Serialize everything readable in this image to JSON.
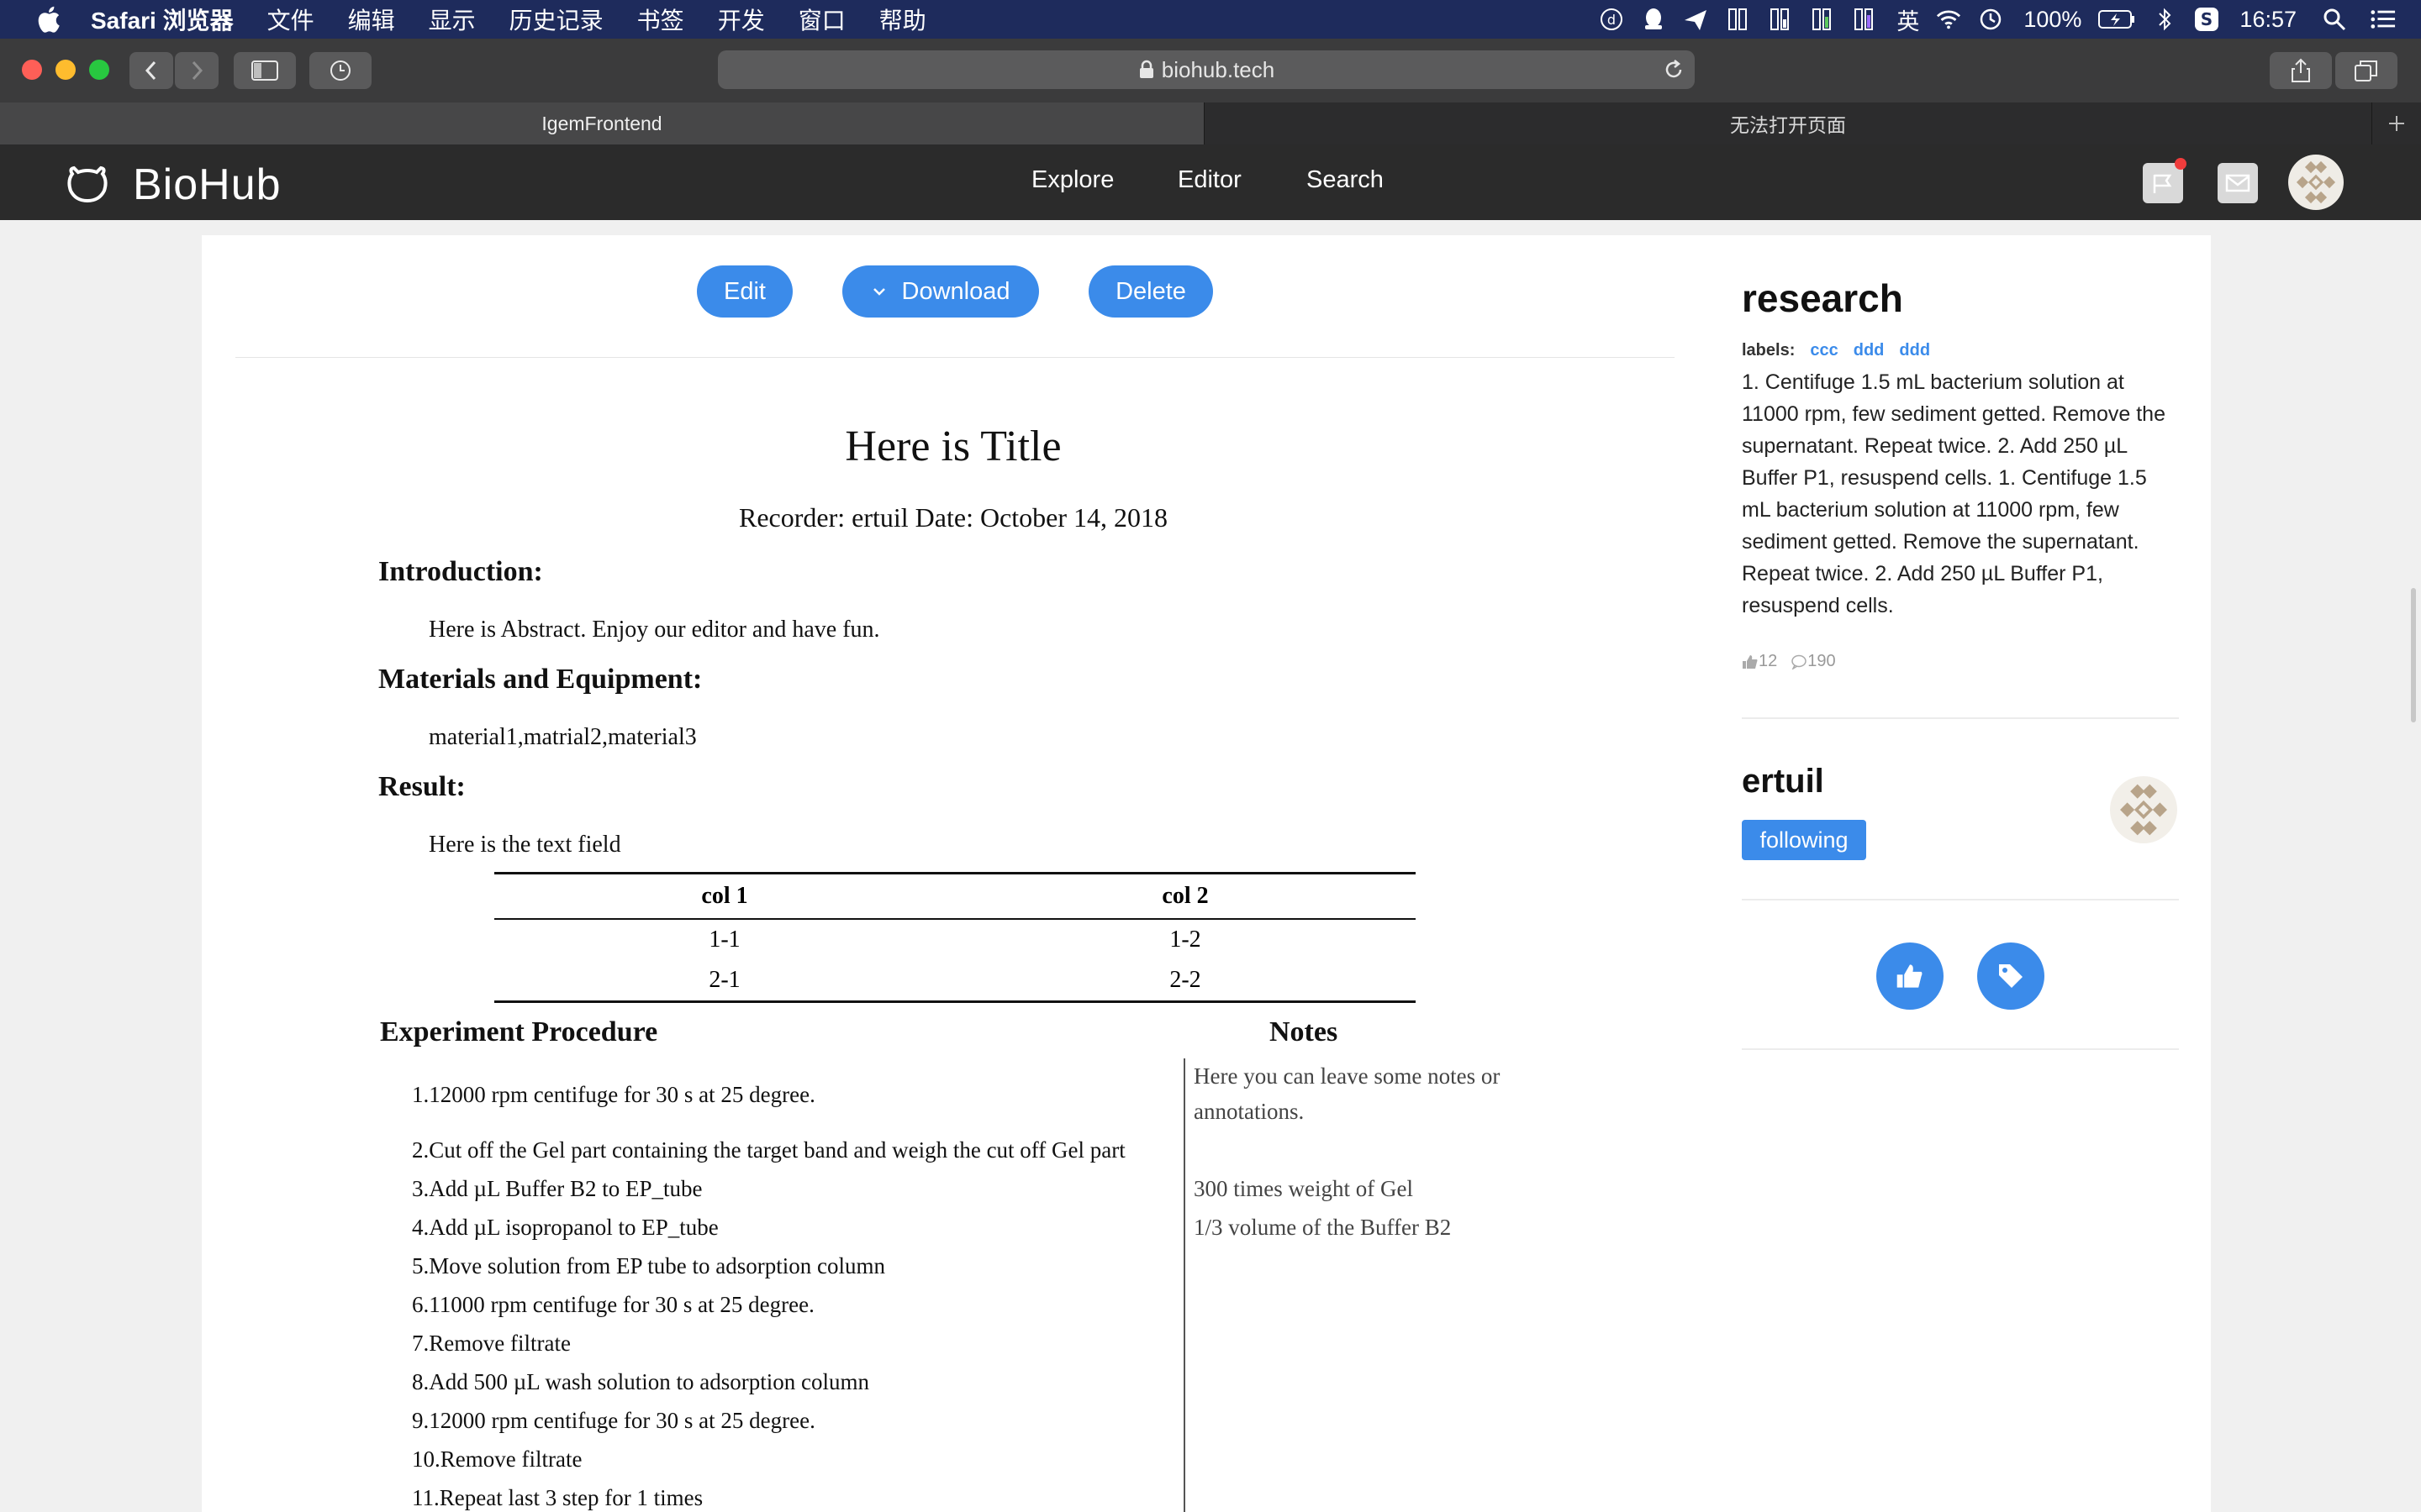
{
  "menubar": {
    "app": "Safari 浏览器",
    "items": [
      "文件",
      "编辑",
      "显示",
      "历史记录",
      "书签",
      "开发",
      "窗口",
      "帮助"
    ],
    "battery": "100%",
    "time": "16:57",
    "ime": "英"
  },
  "browser": {
    "url": "biohub.tech",
    "tabs": [
      {
        "label": "IgemFrontend",
        "active": true
      },
      {
        "label": "无法打开页面",
        "active": false
      }
    ]
  },
  "site": {
    "brand": "BioHub",
    "nav": [
      "Explore",
      "Editor",
      "Search"
    ]
  },
  "actions": {
    "edit": "Edit",
    "download": "Download",
    "delete": "Delete"
  },
  "doc": {
    "title": "Here is Title",
    "recorder": "Recorder: ertuil  Date: October 14, 2018",
    "intro_heading": "Introduction:",
    "intro_text": "Here is Abstract. Enjoy our editor and have fun.",
    "materials_heading": "Materials and Equipment:",
    "materials_text": "material1,matrial2,material3",
    "result_heading": "Result:",
    "result_text": "Here is the text field",
    "table": {
      "headers": [
        "col 1",
        "col 2"
      ],
      "rows": [
        [
          "1-1",
          "1-2"
        ],
        [
          "2-1",
          "2-2"
        ]
      ]
    },
    "procedure_heading": "Experiment Procedure",
    "notes_heading": "Notes",
    "steps": [
      "1.12000 rpm centifuge for 30 s at 25 degree.",
      "2.Cut off the Gel part containing the target band and weigh the cut off Gel part",
      "3.Add µL Buffer B2 to EP_tube",
      "4.Add µL isopropanol to EP_tube",
      "5.Move solution from EP tube to adsorption column",
      "6.11000 rpm centifuge for 30 s at 25 degree.",
      "7.Remove filtrate",
      "8.Add 500 µL wash solution to adsorption column",
      "9.12000 rpm centifuge for 30 s at 25 degree.",
      "10.Remove filtrate",
      "11.Repeat last 3 step for 1 times"
    ],
    "notes": [
      "Here you can leave some notes or",
      "annotations.",
      "300 times weight of Gel",
      "1/3 volume of the Buffer B2"
    ]
  },
  "sidebar": {
    "title": "research",
    "labels_caption": "labels:",
    "labels": [
      "ccc",
      "ddd",
      "ddd"
    ],
    "description": "1. Centifuge 1.5 mL bacterium solution at 11000 rpm, few sediment getted. Remove the supernatant. Repeat twice. 2. Add 250 µL Buffer P1, resuspend cells. 1. Centifuge 1.5 mL bacterium solution at 11000 rpm, few sediment getted. Remove the supernatant. Repeat twice. 2. Add 250 µL Buffer P1, resuspend cells.",
    "likes": "12",
    "comments": "190",
    "author": "ertuil",
    "follow_label": "following"
  },
  "colors": {
    "accent": "#3b8bea",
    "header_bg": "#2b2b2b",
    "menubar_bg": "#1e2b5c"
  }
}
